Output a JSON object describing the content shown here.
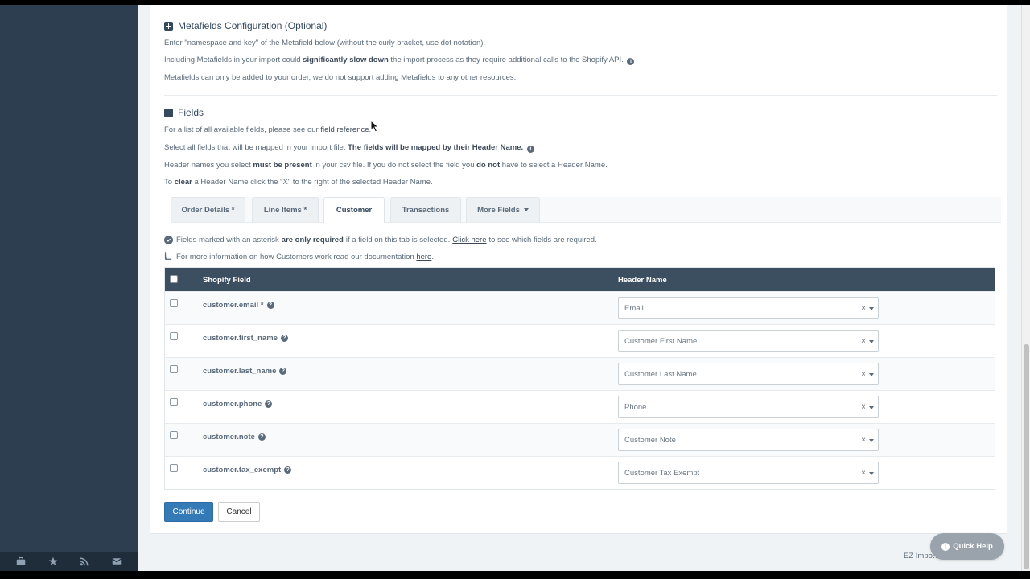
{
  "metafields": {
    "title": "Metafields Configuration (Optional)",
    "line1": "Enter \"namespace and key\" of the Metafield below (without the curly bracket, use dot notation).",
    "line2_pre": "Including Metafields in your import could ",
    "line2_bold": "significantly slow down",
    "line2_post": " the import process as they require additional calls to the Shopify API.",
    "line3": "Metafields can only be added to your order, we do not support adding Metafields to any other resources."
  },
  "fields": {
    "title": "Fields",
    "line1_pre": "For a list of all available fields, please see our ",
    "line1_link": "field reference",
    "line1_post": ".",
    "line2_pre": "Select all fields that will be mapped in your import file. ",
    "line2_bold": "The fields will be mapped by their Header Name.",
    "line3_a": "Header names you select ",
    "line3_b": "must be present",
    "line3_c": " in your csv file. If you do not select the field you ",
    "line3_d": "do not",
    "line3_e": " have to select a Header Name.",
    "line4_a": "To ",
    "line4_b": "clear",
    "line4_c": " a Header Name click the \"X\" to the right of the selected Header Name."
  },
  "tabs": [
    {
      "label": "Order Details *"
    },
    {
      "label": "Line Items *"
    },
    {
      "label": "Customer"
    },
    {
      "label": "Transactions"
    },
    {
      "label": "More Fields"
    }
  ],
  "notice": {
    "required_pre": "Fields marked with an asterisk",
    "required_bold": "are only required",
    "required_mid": "if a field on this tab is selected.",
    "required_link": "Click here",
    "required_post": "to see which fields are required.",
    "info_pre": "For more information on how Customers work read our documentation",
    "info_link": "here",
    "info_post": "."
  },
  "table": {
    "col_field": "Shopify Field",
    "col_header": "Header Name",
    "rows": [
      {
        "field": "customer.email *",
        "header": "Email"
      },
      {
        "field": "customer.first_name",
        "header": "Customer First Name"
      },
      {
        "field": "customer.last_name",
        "header": "Customer Last Name"
      },
      {
        "field": "customer.phone",
        "header": "Phone"
      },
      {
        "field": "customer.note",
        "header": "Customer Note"
      },
      {
        "field": "customer.tax_exempt",
        "header": "Customer Tax Exempt"
      }
    ]
  },
  "buttons": {
    "continue": "Continue",
    "cancel": "Cancel"
  },
  "quick_help": "Quick Help",
  "footer": "EZ Impo… Advanced Apps",
  "colors": {
    "sidebar": "#2c3e50",
    "table_header": "#3c4f61",
    "primary": "#337ab7"
  }
}
